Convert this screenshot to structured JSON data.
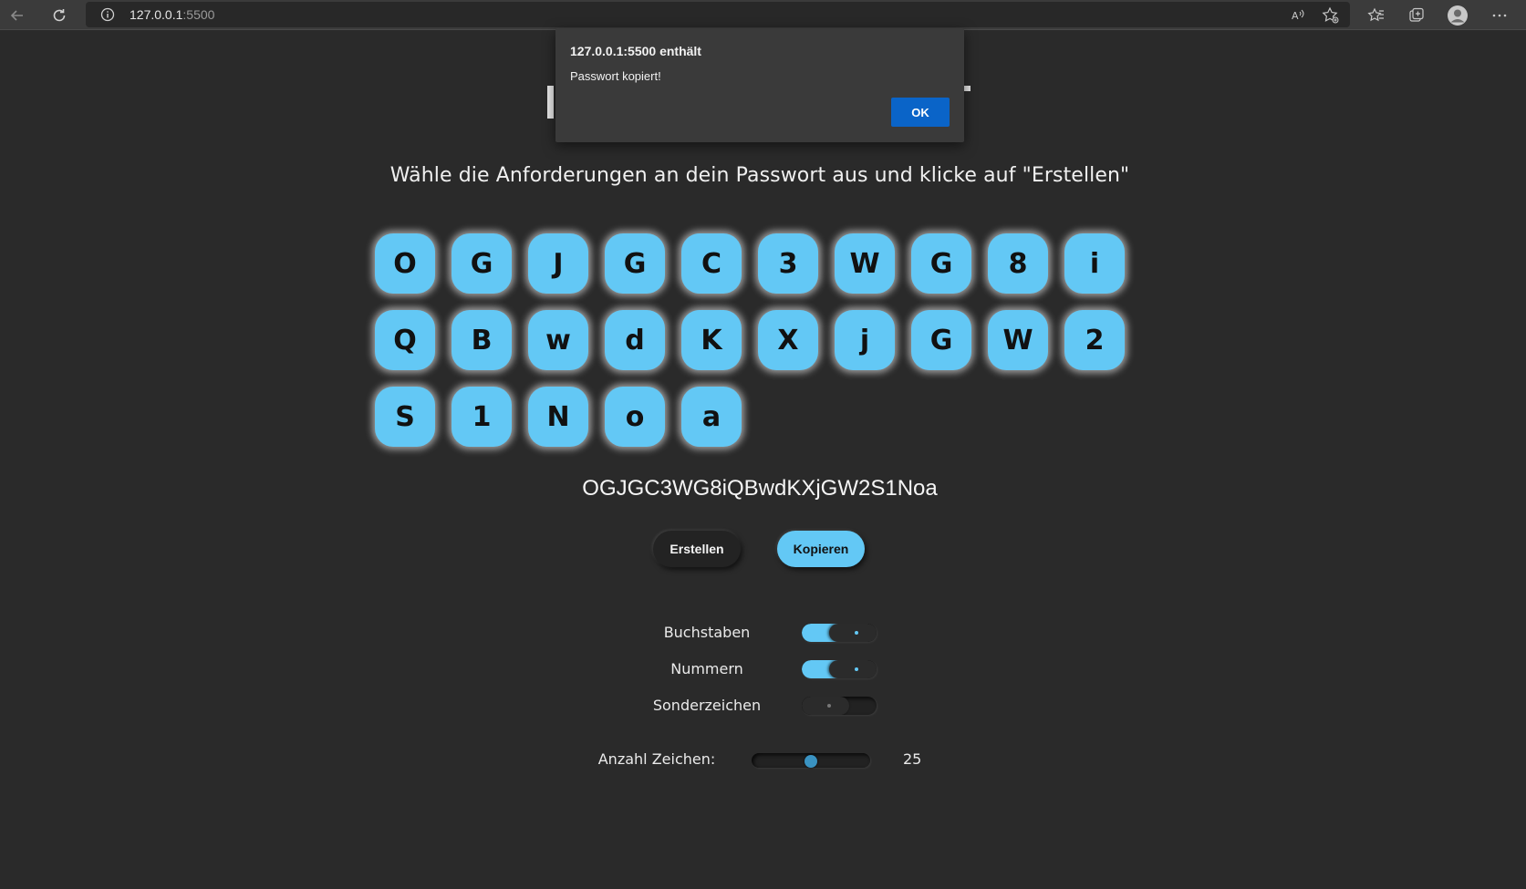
{
  "browser": {
    "address_host": "127.0.0.1",
    "address_port": ":5500",
    "icons": [
      "back-arrow-icon",
      "reload-icon",
      "info-icon",
      "read-aloud-icon",
      "add-favorite-icon",
      "favorites-icon",
      "collections-icon",
      "profile-icon",
      "more-icon"
    ]
  },
  "page": {
    "instructions": "Wähle die Anforderungen an dein Passwort aus und klicke auf \"Erstellen\"",
    "characters": [
      "O",
      "G",
      "J",
      "G",
      "C",
      "3",
      "W",
      "G",
      "8",
      "i",
      "Q",
      "B",
      "w",
      "d",
      "K",
      "X",
      "j",
      "G",
      "W",
      "2",
      "S",
      "1",
      "N",
      "o",
      "a"
    ],
    "password": "OGJGC3WG8iQBwdKXjGW2S1Noa",
    "buttons": {
      "create": "Erstellen",
      "copy": "Kopieren"
    },
    "options": [
      {
        "label": "Buchstaben",
        "checked": true
      },
      {
        "label": "Nummern",
        "checked": true
      },
      {
        "label": "Sonderzeichen",
        "checked": false
      }
    ],
    "length": {
      "label": "Anzahl Zeichen:",
      "value": "25",
      "fraction": 0.5
    },
    "colors": {
      "accent": "#63c8f5",
      "background": "#2a2a2a"
    }
  },
  "dialog": {
    "title": "127.0.0.1:5500 enthält",
    "message": "Passwort kopiert!",
    "ok_label": "OK"
  }
}
